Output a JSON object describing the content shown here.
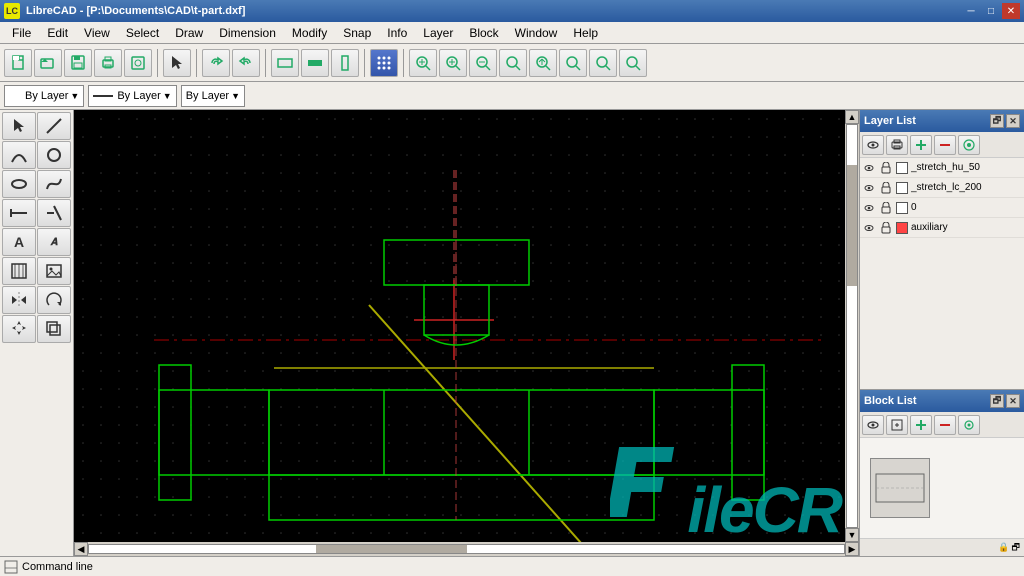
{
  "titlebar": {
    "title": "LibreCAD - [P:\\Documents\\CAD\\t-part.dxf]",
    "icon_label": "LC",
    "btn_minimize": "─",
    "btn_restore": "□",
    "btn_close": "✕"
  },
  "menubar": {
    "items": [
      "File",
      "Edit",
      "View",
      "Select",
      "Draw",
      "Dimension",
      "Modify",
      "Snap",
      "Info",
      "Layer",
      "Block",
      "Window",
      "Help"
    ]
  },
  "toolbar": {
    "buttons": [
      {
        "name": "new",
        "icon": "📄"
      },
      {
        "name": "open",
        "icon": "📂"
      },
      {
        "name": "save",
        "icon": "💾"
      },
      {
        "name": "print",
        "icon": "🖨"
      },
      {
        "name": "print-preview",
        "icon": "👁"
      },
      {
        "name": "pointer",
        "icon": "↖"
      },
      {
        "name": "zoom-pan",
        "icon": "✋"
      },
      {
        "name": "redo",
        "icon": "↷"
      },
      {
        "name": "block1",
        "icon": "▭"
      },
      {
        "name": "block2",
        "icon": "▬"
      },
      {
        "name": "block3",
        "icon": "▮"
      },
      {
        "name": "snap-grid",
        "icon": "⠿"
      },
      {
        "name": "zoom-in",
        "icon": "🔍"
      },
      {
        "name": "zoom-out",
        "icon": "🔎"
      },
      {
        "name": "zoom-window",
        "icon": "⊕"
      },
      {
        "name": "zoom-fit",
        "icon": "⊞"
      },
      {
        "name": "zoom-pan2",
        "icon": "⊠"
      },
      {
        "name": "zoom-all",
        "icon": "⊟"
      },
      {
        "name": "zoom-prev",
        "icon": "⊗"
      }
    ]
  },
  "toolbar2": {
    "color_label": "By Layer",
    "line_label": "By Layer",
    "width_label": "By Layer"
  },
  "left_tools": {
    "tools": [
      {
        "name": "select-pointer",
        "icon": "↖",
        "row": 0
      },
      {
        "name": "draw-line",
        "icon": "╱",
        "row": 0
      },
      {
        "name": "arc",
        "icon": "◜",
        "row": 1
      },
      {
        "name": "circle",
        "icon": "○",
        "row": 1
      },
      {
        "name": "ellipse",
        "icon": "⬭",
        "row": 2
      },
      {
        "name": "spline",
        "icon": "〜",
        "row": 2
      },
      {
        "name": "line-h",
        "icon": "─",
        "row": 3
      },
      {
        "name": "trim",
        "icon": "✂",
        "row": 3
      },
      {
        "name": "text",
        "icon": "A",
        "row": 4
      },
      {
        "name": "text-big",
        "icon": "𝐀",
        "row": 4
      },
      {
        "name": "hatch",
        "icon": "▦",
        "row": 5
      },
      {
        "name": "image",
        "icon": "🖼",
        "row": 5
      },
      {
        "name": "mirror",
        "icon": "⇌",
        "row": 6
      },
      {
        "name": "rotate",
        "icon": "↺",
        "row": 6
      },
      {
        "name": "move",
        "icon": "✛",
        "row": 7
      },
      {
        "name": "copy",
        "icon": "⧉",
        "row": 7
      }
    ]
  },
  "layer_list": {
    "title": "Layer List",
    "layers": [
      {
        "name": "_stretch_hu_50",
        "visible": true,
        "locked": true,
        "color": "#ffffff"
      },
      {
        "name": "_stretch_lc_200",
        "visible": true,
        "locked": true,
        "color": "#ffffff"
      },
      {
        "name": "0",
        "visible": true,
        "locked": true,
        "color": "#ffffff"
      },
      {
        "name": "auxiliary",
        "visible": true,
        "locked": true,
        "color": "#ff0000"
      }
    ]
  },
  "block_list": {
    "title": "Block List"
  },
  "statusbar": {
    "label": "Command line"
  },
  "scrollbar": {
    "h_thumb_left": "30%",
    "h_thumb_width": "20%",
    "v_thumb_top": "10%",
    "v_thumb_height": "30%"
  },
  "layer_colors": {
    "_stretch_hu_50": "#ffffff",
    "_stretch_lc_200": "#ffffff",
    "0": "#ffffff",
    "auxiliary": "#ff4444"
  }
}
